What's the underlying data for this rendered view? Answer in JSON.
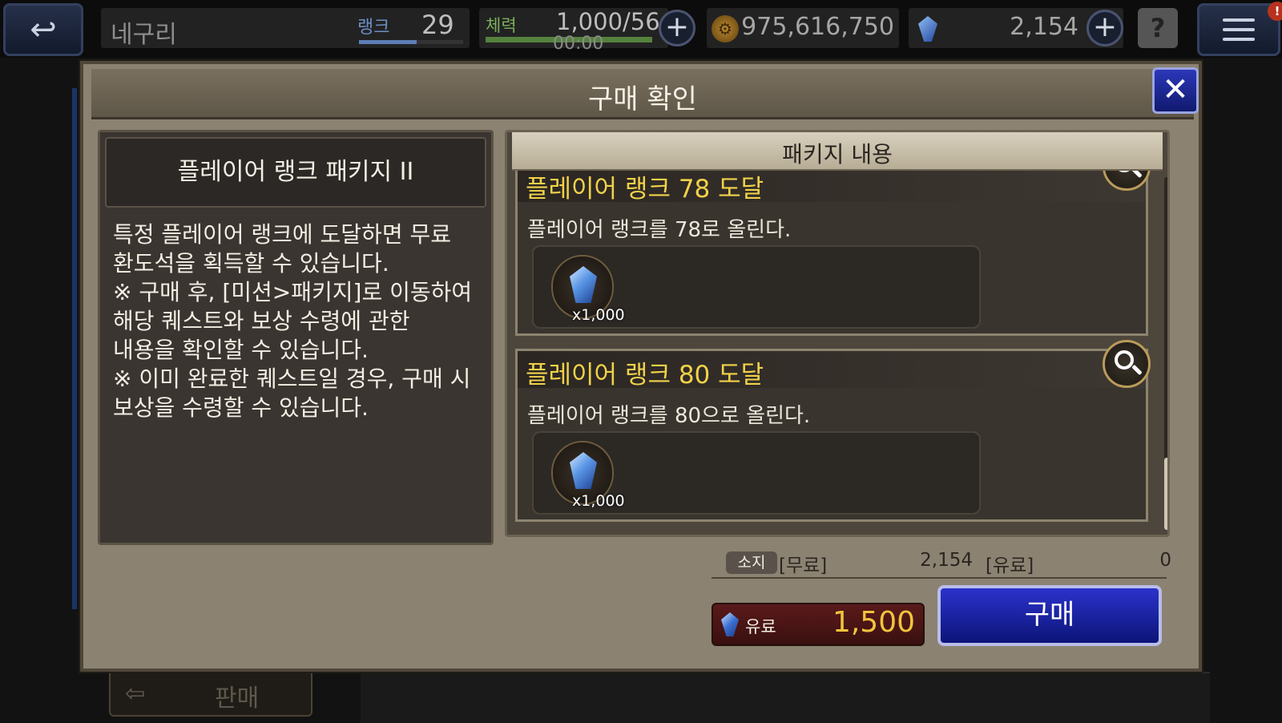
{
  "top_bar": {
    "player_name": "네구리",
    "rank_label": "랭크",
    "rank_value": "29",
    "rank_progress": 0.55,
    "stamina_label": "체력",
    "stamina_value": "1,000/56",
    "stamina_timer": "00:00",
    "stamina_fill": 1.0,
    "gold_value": "975,616,750",
    "gem_value": "2,154",
    "notification_badge": "!",
    "icons": [
      "back-arrow-icon",
      "plus-icon",
      "coin-icon",
      "crystal-icon",
      "help-icon",
      "hamburger-menu-icon"
    ]
  },
  "background": {
    "sell_label": "판매"
  },
  "dialog": {
    "title": "구매 확인",
    "package_name": "플레이어 랭크 패키지 II",
    "package_description": "특정 플레이어 랭크에 도달하면 무료\n환도석을 획득할 수 있습니다.\n※ 구매 후, [미션>패키지]로 이동하여\n해당 퀘스트와 보상 수령에 관한\n내용을 확인할 수 있습니다.\n※ 이미 완료한 퀘스트일 경우, 구매 시\n보상을 수령할 수 있습니다.",
    "contents_title": "패키지 내용",
    "quests": [
      {
        "title": "플레이어 랭크 78 도달",
        "description": "플레이어 랭크를 78로 올린다.",
        "reward_qty": "x1,000"
      },
      {
        "title": "플레이어 랭크 80 도달",
        "description": "플레이어 랭크를 80으로 올린다.",
        "reward_qty": "x1,000"
      }
    ],
    "owned_label": "소지",
    "free_label": "[무료]",
    "free_value": "2,154",
    "paid_label": "[유료]",
    "paid_value": "0",
    "price_label": "유료",
    "price_value": "1,500",
    "buy_label": "구매",
    "accent_colors": {
      "quest_title": "#f1d24a",
      "price": "#f0c43c",
      "buy_button": "#2b32cc"
    }
  }
}
